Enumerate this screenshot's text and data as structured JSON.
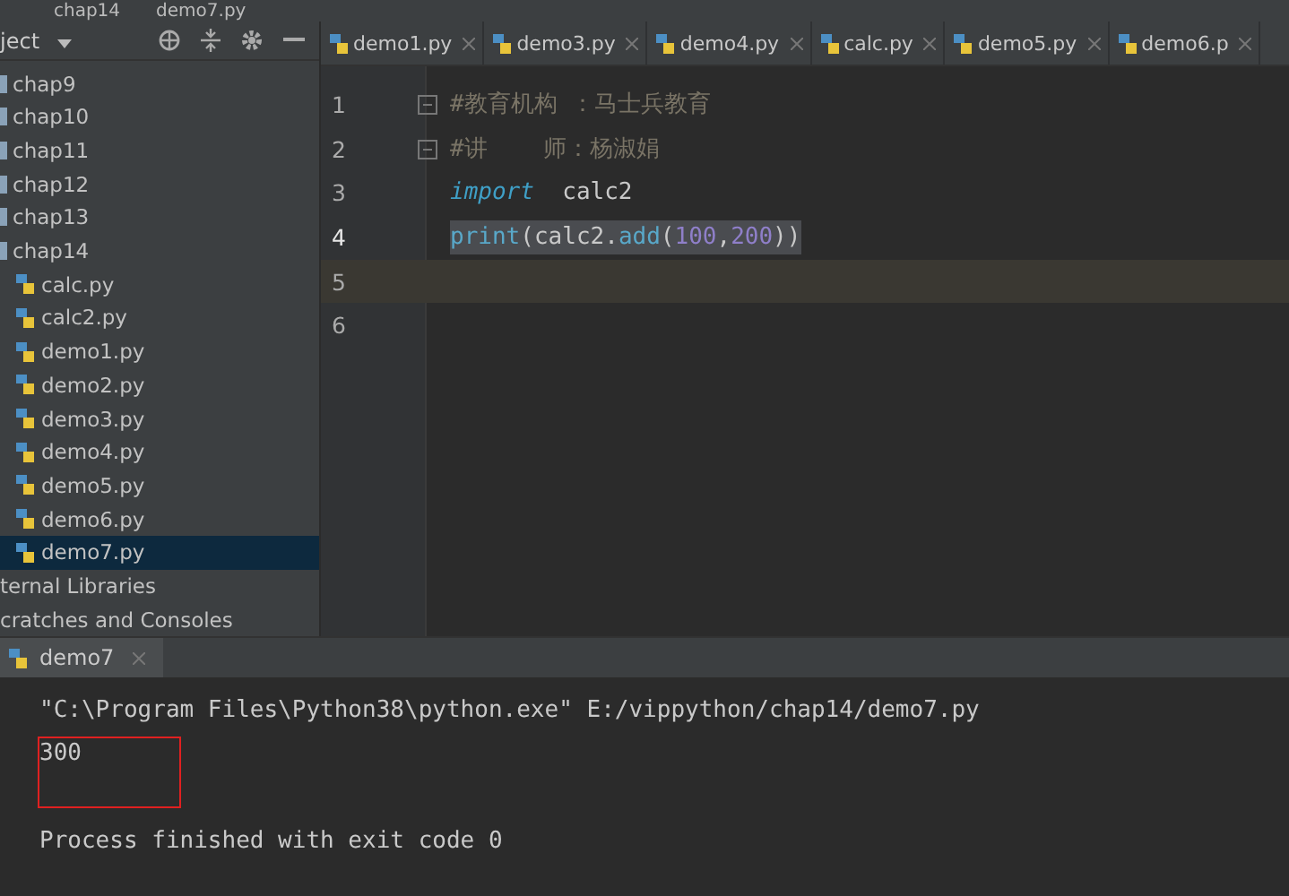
{
  "breadcrumbs": [
    "chap14",
    "demo7.py"
  ],
  "project_panel": {
    "title": "ject",
    "tree": [
      {
        "label": "chap9",
        "kind": "folder",
        "selected": false
      },
      {
        "label": "chap10",
        "kind": "folder",
        "selected": false
      },
      {
        "label": "chap11",
        "kind": "folder",
        "selected": false
      },
      {
        "label": "chap12",
        "kind": "folder",
        "selected": false
      },
      {
        "label": "chap13",
        "kind": "folder",
        "selected": false
      },
      {
        "label": "chap14",
        "kind": "folder",
        "selected": false,
        "children": [
          {
            "label": "calc.py",
            "kind": "file",
            "selected": false
          },
          {
            "label": "calc2.py",
            "kind": "file",
            "selected": false
          },
          {
            "label": "demo1.py",
            "kind": "file",
            "selected": false
          },
          {
            "label": "demo2.py",
            "kind": "file",
            "selected": false
          },
          {
            "label": "demo3.py",
            "kind": "file",
            "selected": false
          },
          {
            "label": "demo4.py",
            "kind": "file",
            "selected": false
          },
          {
            "label": "demo5.py",
            "kind": "file",
            "selected": false
          },
          {
            "label": "demo6.py",
            "kind": "file",
            "selected": false
          },
          {
            "label": "demo7.py",
            "kind": "file",
            "selected": true
          }
        ]
      },
      {
        "label": "ternal Libraries",
        "kind": "library",
        "selected": false
      },
      {
        "label": "cratches and Consoles",
        "kind": "library",
        "selected": false
      }
    ]
  },
  "editor_tabs": [
    {
      "label": "demo1.py",
      "selected": false
    },
    {
      "label": "demo3.py",
      "selected": false
    },
    {
      "label": "demo4.py",
      "selected": false
    },
    {
      "label": "calc.py",
      "selected": false
    },
    {
      "label": "demo5.py",
      "selected": false
    },
    {
      "label": "demo6.p",
      "selected": false
    }
  ],
  "code_lines": [
    {
      "number": "1",
      "highlighted": false,
      "current": false,
      "fold": true,
      "tokens": [
        {
          "kind": "comment",
          "text": "#教育机构 ：马士兵教育"
        }
      ]
    },
    {
      "number": "2",
      "highlighted": false,
      "current": false,
      "fold": true,
      "tokens": [
        {
          "kind": "comment",
          "text": "#讲    师：杨淑娟"
        }
      ]
    },
    {
      "number": "3",
      "highlighted": false,
      "current": false,
      "fold": false,
      "tokens": [
        {
          "kind": "keyword",
          "text": "import"
        },
        {
          "kind": "plain",
          "text": "  calc2"
        }
      ]
    },
    {
      "number": "4",
      "highlighted": true,
      "current": false,
      "fold": false,
      "tokens": [
        {
          "kind": "builtin",
          "text": "print"
        },
        {
          "kind": "plain",
          "text": "(calc2."
        },
        {
          "kind": "builtin",
          "text": "add"
        },
        {
          "kind": "plain",
          "text": "("
        },
        {
          "kind": "number",
          "text": "100"
        },
        {
          "kind": "plain",
          "text": ","
        },
        {
          "kind": "number",
          "text": "200"
        },
        {
          "kind": "plain",
          "text": "))"
        }
      ]
    },
    {
      "number": "5",
      "highlighted": false,
      "current": true,
      "fold": false
    },
    {
      "number": "6",
      "highlighted": false,
      "current": false,
      "fold": false
    }
  ],
  "run_panel": {
    "tab": "demo7",
    "output": [
      {
        "text": "\"C:\\Program Files\\Python38\\python.exe\" E:/vippython/chap14/demo7.py",
        "boxed": false
      },
      {
        "text": "300",
        "boxed": true
      },
      {
        "text": "Process finished with exit code 0",
        "boxed": false
      }
    ]
  }
}
